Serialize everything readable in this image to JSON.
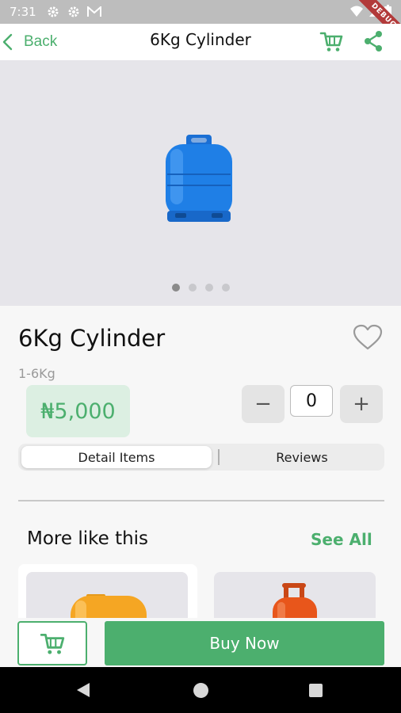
{
  "status_bar": {
    "time": "7:31",
    "debug_banner": "DEBUG"
  },
  "app_bar": {
    "back_label": "Back",
    "title": "6Kg Cylinder"
  },
  "hero": {
    "image_count": 4,
    "active_index": 0
  },
  "product": {
    "name": "6Kg Cylinder",
    "subtitle": "1-6Kg",
    "price": "₦5,000",
    "quantity": "0",
    "favorited": false
  },
  "quantity_controls": {
    "minus_label": "−",
    "plus_label": "+"
  },
  "tabs": [
    {
      "label": "Detail Items",
      "active": true
    },
    {
      "label": "Reviews",
      "active": false
    }
  ],
  "related": {
    "title": "More like this",
    "see_all_label": "See All"
  },
  "actions": {
    "buy_label": "Buy Now"
  },
  "colors": {
    "accent": "#4caf6e",
    "accent_light": "#dcefe2",
    "image_bg": "#e6e5ea",
    "cylinder_blue": "#1f7fe6",
    "cylinder_yellow": "#f5a623",
    "cylinder_orange": "#e8561b"
  }
}
